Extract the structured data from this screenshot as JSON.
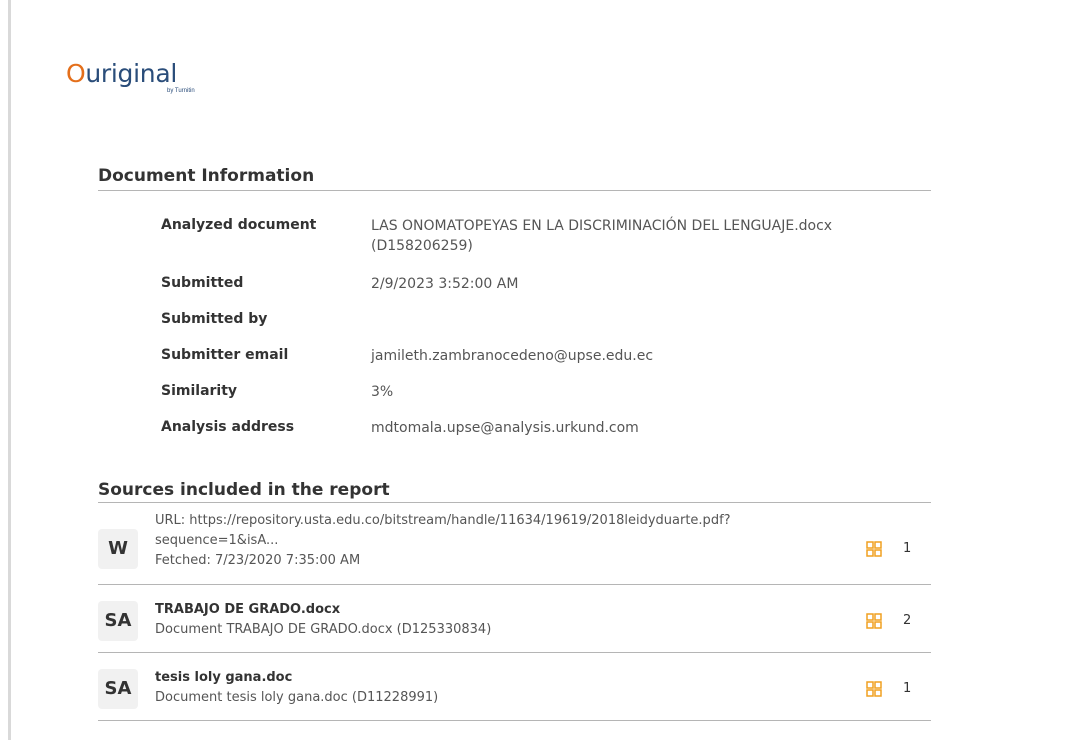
{
  "logo": {
    "o": "O",
    "rest": "uriginal",
    "tagline": "by Turnitin"
  },
  "document_information": {
    "heading": "Document Information",
    "rows": [
      {
        "label": "Analyzed document",
        "value_line1": "LAS ONOMATOPEYAS EN LA DISCRIMINACIÓN DEL LENGUAJE.docx",
        "value_line2": "(D158206259)"
      },
      {
        "label": "Submitted",
        "value": "2/9/2023 3:52:00 AM"
      },
      {
        "label": "Submitted by",
        "value": ""
      },
      {
        "label": "Submitter email",
        "value": "jamileth.zambranocedeno@upse.edu.ec"
      },
      {
        "label": "Similarity",
        "value": "3%"
      },
      {
        "label": "Analysis address",
        "value": "mdtomala.upse@analysis.urkund.com"
      }
    ]
  },
  "sources": {
    "heading": "Sources included in the report",
    "items": [
      {
        "badge": "W",
        "line1": "URL: https://repository.usta.edu.co/bitstream/handle/11634/19619/2018leidyduarte.pdf?",
        "line2": "sequence=1&isA...",
        "line3": "Fetched: 7/23/2020 7:35:00 AM",
        "count": "1"
      },
      {
        "badge": "SA",
        "title": "TRABAJO DE GRADO.docx",
        "subtitle": "Document TRABAJO DE GRADO.docx (D125330834)",
        "count": "2"
      },
      {
        "badge": "SA",
        "title": "tesis loly gana.doc",
        "subtitle": "Document tesis loly gana.doc (D11228991)",
        "count": "1"
      }
    ]
  },
  "colors": {
    "accent_orange": "#e46f1b",
    "brand_blue": "#2a4d7a",
    "grid_icon": "#f0a020"
  }
}
